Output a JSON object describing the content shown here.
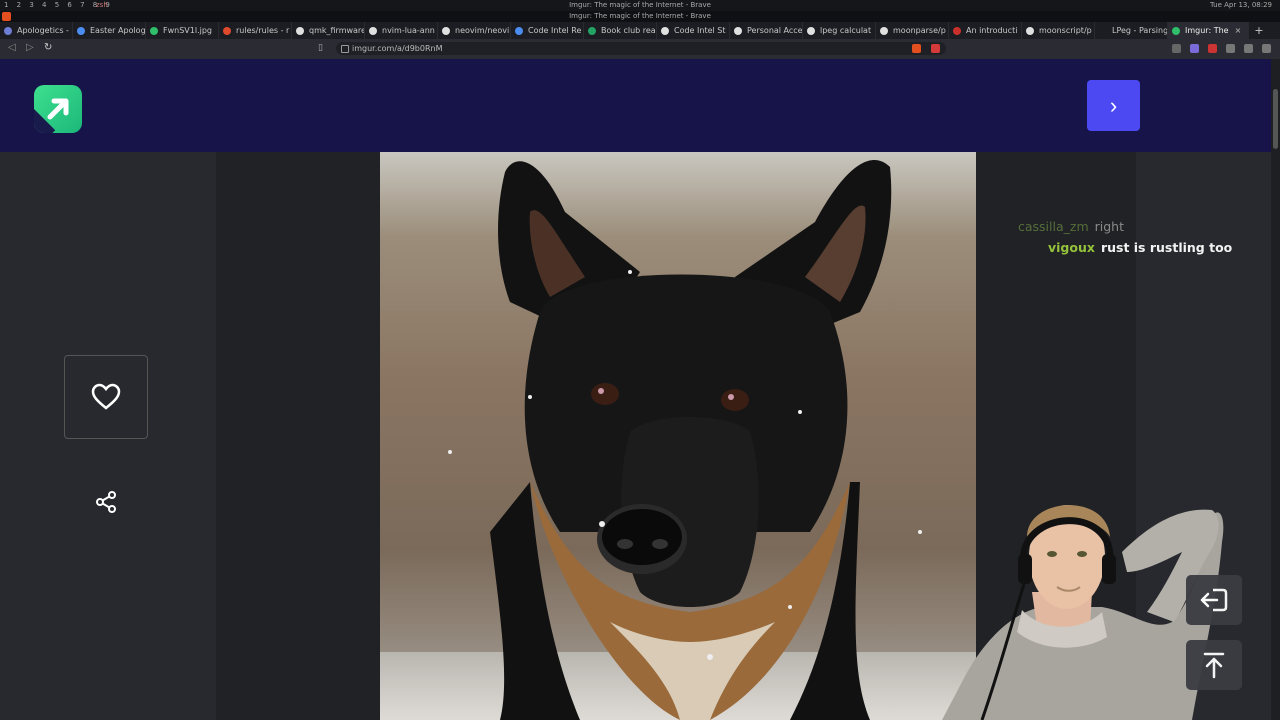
{
  "os": {
    "workspaces": "1 2 3 4 5 6 7 8 9",
    "terminal": "zsh",
    "window_title": "Imgur: The magic of the Internet - Brave",
    "clock": "Tue Apr 13, 08:29"
  },
  "browser": {
    "title_strip": "Imgur: The magic of the Internet - Brave",
    "tabs": [
      {
        "label": "Apologetics -",
        "color": "#6e7dd6"
      },
      {
        "label": "Easter Apolog",
        "color": "#4a8df0"
      },
      {
        "label": "FwnSV1l.jpg",
        "color": "#2fbf6b"
      },
      {
        "label": "rules/rules - r",
        "color": "#e04a2c"
      },
      {
        "label": "qmk_firmware",
        "color": "#e0e0e0"
      },
      {
        "label": "nvim-lua-ann",
        "color": "#e0e0e0"
      },
      {
        "label": "neovim/neovi",
        "color": "#e0e0e0"
      },
      {
        "label": "Code Intel Re",
        "color": "#4a8df0"
      },
      {
        "label": "Book club rea",
        "color": "#21a464"
      },
      {
        "label": "Code Intel St",
        "color": "#e0e0e0"
      },
      {
        "label": "Personal Acce",
        "color": "#e0e0e0"
      },
      {
        "label": "lpeg calculat",
        "color": "#e0e0e0"
      },
      {
        "label": "moonparse/p",
        "color": "#e0e0e0"
      },
      {
        "label": "An introducti",
        "color": "#c9302c"
      },
      {
        "label": "moonscript/p",
        "color": "#e0e0e0"
      },
      {
        "label": "LPeg - Parsing",
        "color": "#1c1d22"
      },
      {
        "label": "Imgur: The",
        "color": "#2fbf6b",
        "active": true
      }
    ],
    "url": "imgur.com/a/d9b0RnM",
    "new_tab": "+",
    "close_tab": "×"
  },
  "imgur": {
    "next_label": "›"
  },
  "chat": [
    {
      "user": "cassilla_zm",
      "message": "right",
      "user_color": "#566e3a"
    },
    {
      "user": "vigoux",
      "message": "rust is rustling too",
      "user_color": "#95c23b"
    }
  ]
}
